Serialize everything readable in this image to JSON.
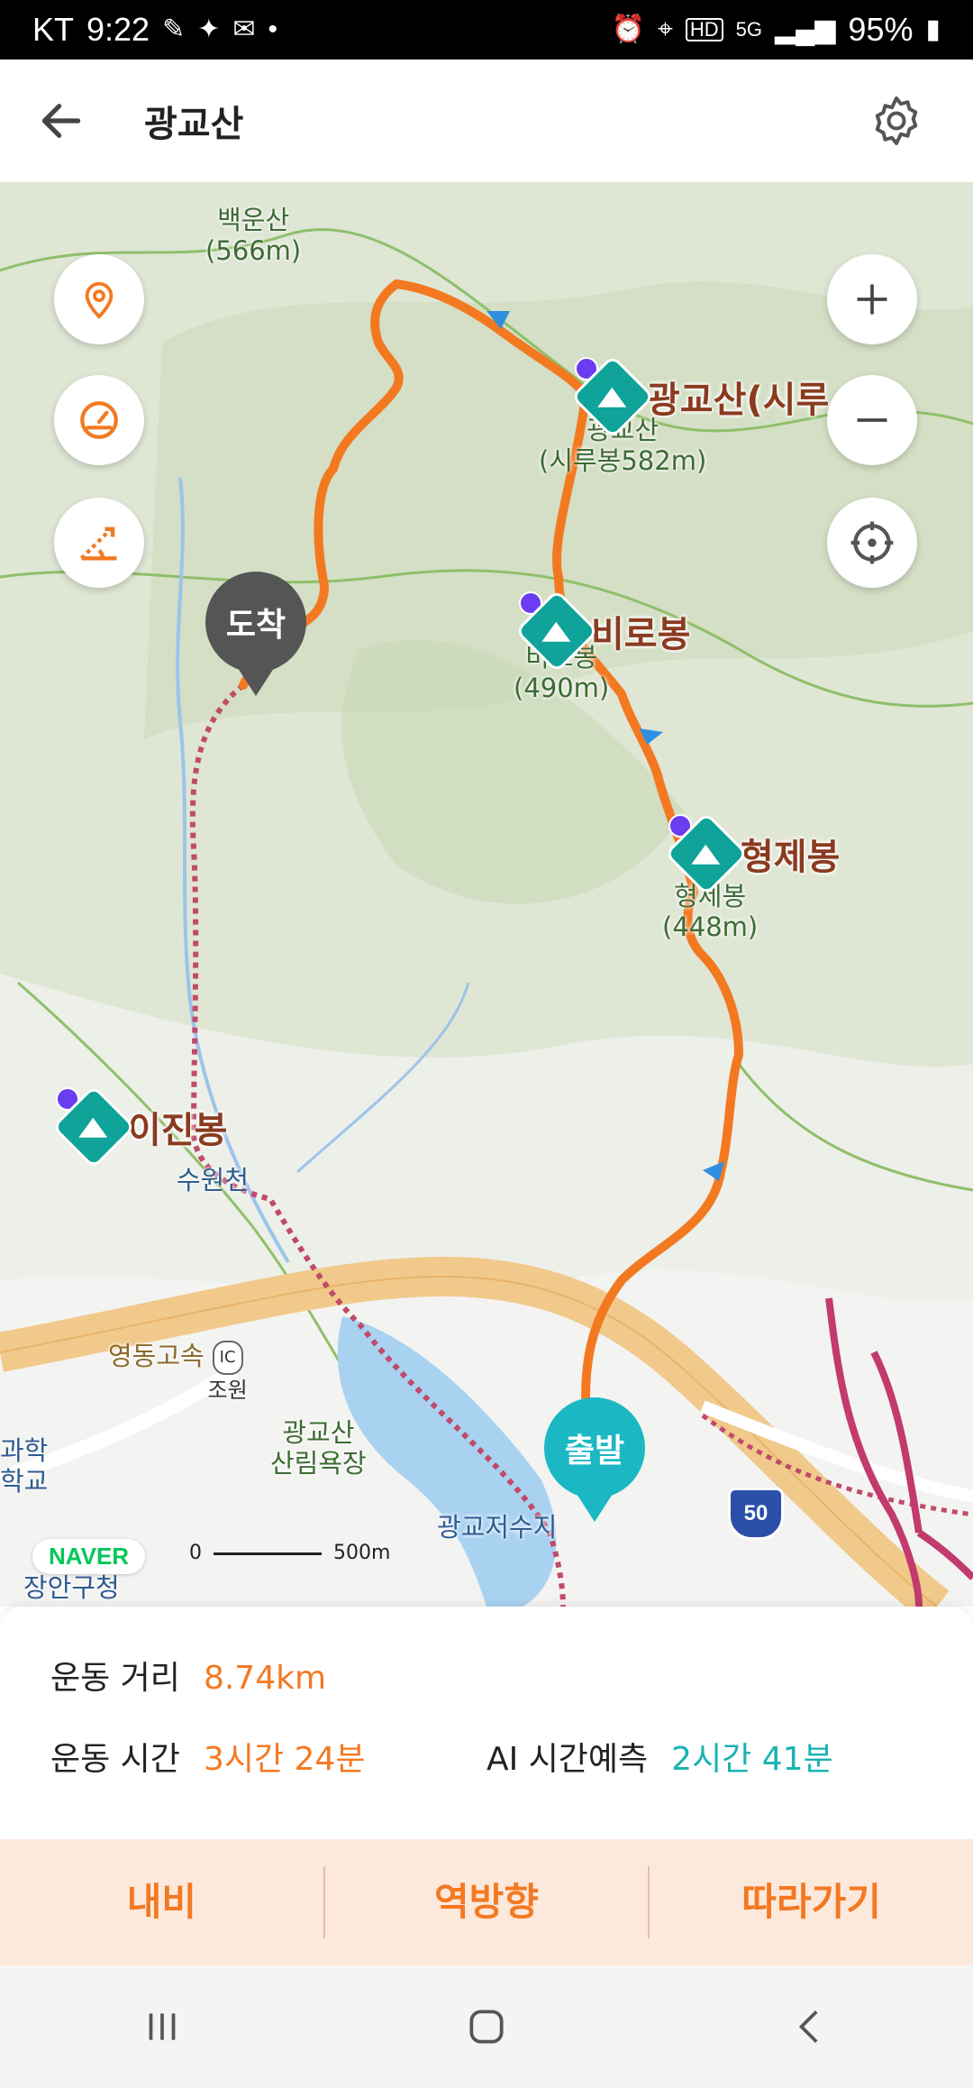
{
  "status_bar": {
    "carrier": "KT",
    "time": "9:22",
    "battery": "95%",
    "icons_left": [
      "notification-icon",
      "notification-icon",
      "notification-icon"
    ],
    "icons_right": [
      "alarm-icon",
      "location-icon",
      "hd-icon",
      "5g-icon",
      "signal-icon",
      "battery-icon"
    ]
  },
  "app_bar": {
    "title": "광교산"
  },
  "map": {
    "labels": {
      "baekunsan": "백운산\n(566m)",
      "gwanggyo_sub": "광교산\n(시루봉582m)",
      "birobong_sub": "비로봉\n(490m)",
      "hyeongje_sub": "형제봉\n(448m)",
      "suwoncheon": "수원천",
      "ic_josun": "조원",
      "yeongdong": "영동고속",
      "forest_bath": "광교산\n산림욕장",
      "reservoir": "광교저수지",
      "gwahak": "과학\n학교",
      "jangan": "장안구청",
      "route50": "50"
    },
    "peaks": [
      {
        "name": "광교산(시루"
      },
      {
        "name": "비로봉"
      },
      {
        "name": "형제봉"
      },
      {
        "name": "이진봉"
      }
    ],
    "end_pin": "도착",
    "start_pin": "출발",
    "naver_logo": "NAVER",
    "scale_start": "0",
    "scale_end": "500m",
    "colors": {
      "route": "#f37921",
      "end_pin": "#555555",
      "start_pin": "#1bb8c4",
      "peak_badge": "#0fa399"
    }
  },
  "stats": {
    "distance_label": "운동 거리",
    "distance_value": "8.74km",
    "time_label": "운동 시간",
    "time_value": "3시간 24분",
    "ai_label": "AI 시간예측",
    "ai_value": "2시간 41분"
  },
  "actions": {
    "navigate": "내비",
    "reverse": "역방향",
    "follow": "따라가기"
  }
}
